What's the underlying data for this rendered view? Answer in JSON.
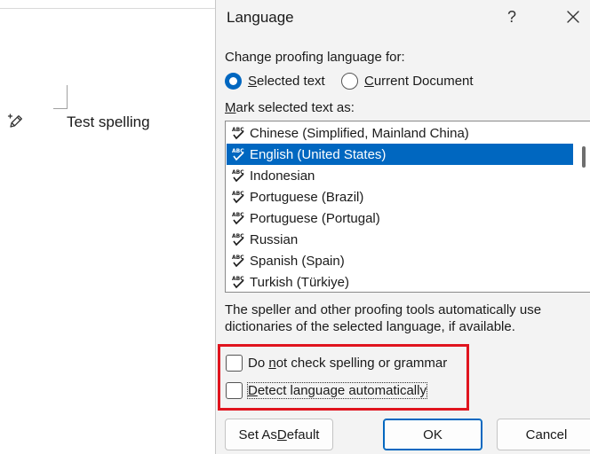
{
  "document": {
    "text": "Test spelling"
  },
  "dialog": {
    "title": "Language",
    "help_label": "?",
    "proofing_label": "Change proofing language for:",
    "radio_selected_text": {
      "prefix": "",
      "mnemonic": "S",
      "rest": "elected text",
      "checked": true
    },
    "radio_current_document": {
      "prefix": "",
      "mnemonic": "C",
      "rest": "urrent Document",
      "checked": false
    },
    "mark_label": {
      "mnemonic": "M",
      "rest": "ark selected text as:"
    },
    "languages": [
      {
        "label": "Chinese (Simplified, Mainland China)",
        "selected": false
      },
      {
        "label": "English (United States)",
        "selected": true
      },
      {
        "label": "Indonesian",
        "selected": false
      },
      {
        "label": "Portuguese (Brazil)",
        "selected": false
      },
      {
        "label": "Portuguese (Portugal)",
        "selected": false
      },
      {
        "label": "Russian",
        "selected": false
      },
      {
        "label": "Spanish (Spain)",
        "selected": false
      },
      {
        "label": "Turkish (Türkiye)",
        "selected": false
      }
    ],
    "description": "The speller and other proofing tools automatically use dictionaries of the selected language, if available.",
    "checkbox_no_check": {
      "prefix": "Do ",
      "mnemonic": "n",
      "rest": "ot check spelling or grammar",
      "checked": false
    },
    "checkbox_detect": {
      "prefix": "",
      "mnemonic": "D",
      "rest": "etect language automatically",
      "checked": false
    },
    "buttons": {
      "set_default": {
        "prefix": "Set As ",
        "mnemonic": "D",
        "rest": "efault"
      },
      "ok": "OK",
      "cancel": "Cancel"
    },
    "colors": {
      "accent": "#0067c0",
      "highlight_box": "#e0141e"
    }
  }
}
